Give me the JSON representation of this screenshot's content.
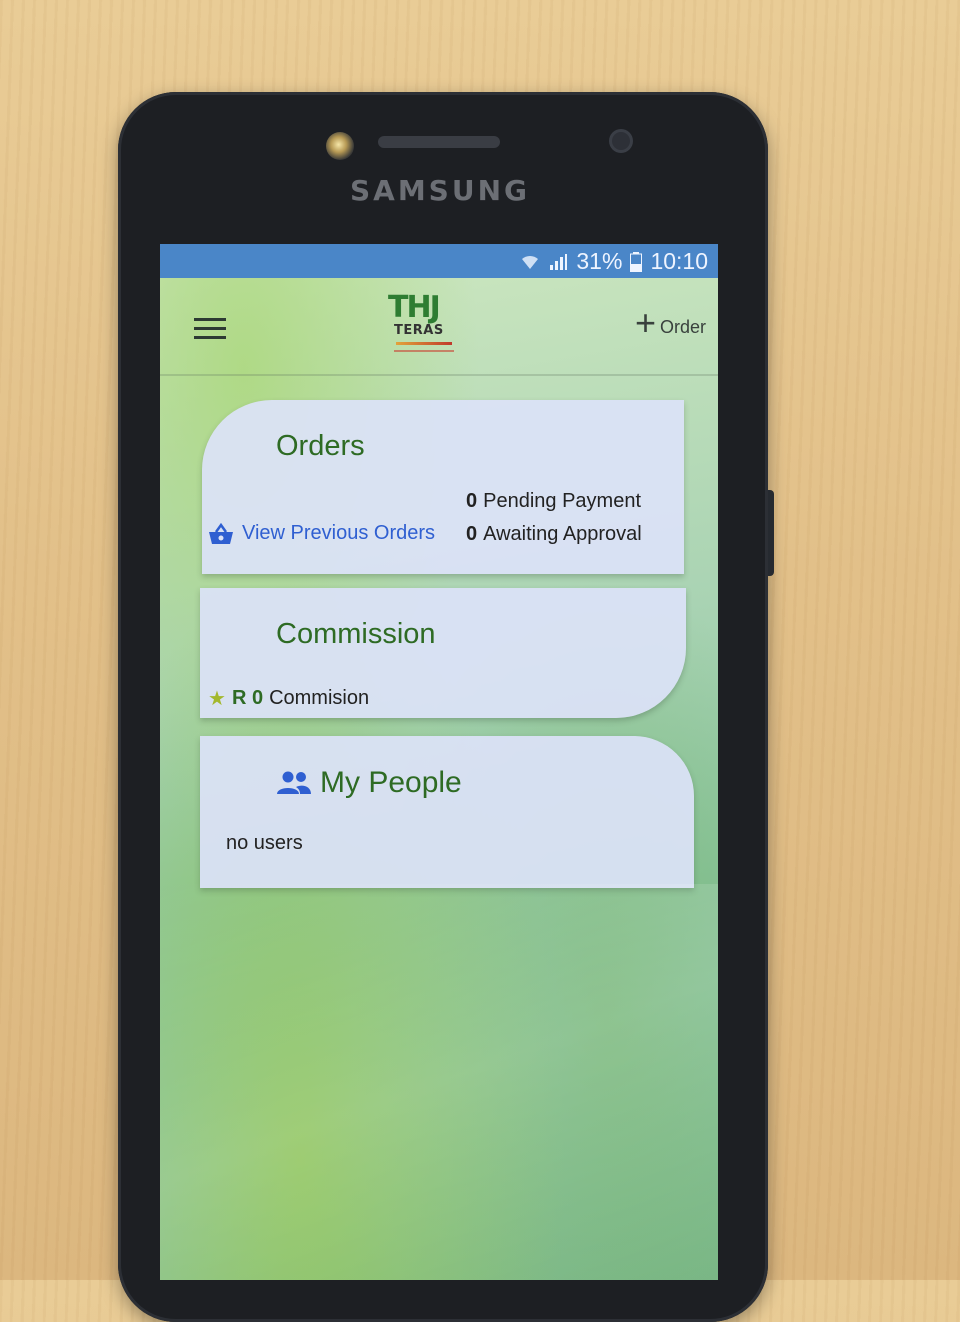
{
  "device": {
    "brand": "SAMSUNG"
  },
  "statusbar": {
    "battery": "31%",
    "time": "10:10",
    "icons": [
      "wifi-icon",
      "signal-icon",
      "battery-icon"
    ]
  },
  "appbar": {
    "logo_main": "THJ",
    "logo_sub": "TERAS",
    "order_button_label": "Order",
    "icons": [
      "menu-icon",
      "plus-icon"
    ]
  },
  "orders_card": {
    "title": "Orders",
    "view_previous_label": "View Previous Orders",
    "pending_count": "0",
    "pending_label": "Pending Payment",
    "awaiting_count": "0",
    "awaiting_label": "Awaiting Approval"
  },
  "commission_card": {
    "title": "Commission",
    "amount": "R 0",
    "label": "Commision"
  },
  "people_card": {
    "title": "My People",
    "empty_text": "no users"
  },
  "colors": {
    "title_green": "#2e6b24",
    "link_blue": "#2f5fd1",
    "statusbar_blue": "#4a86c8",
    "card_bg": "#dbe2f7"
  }
}
